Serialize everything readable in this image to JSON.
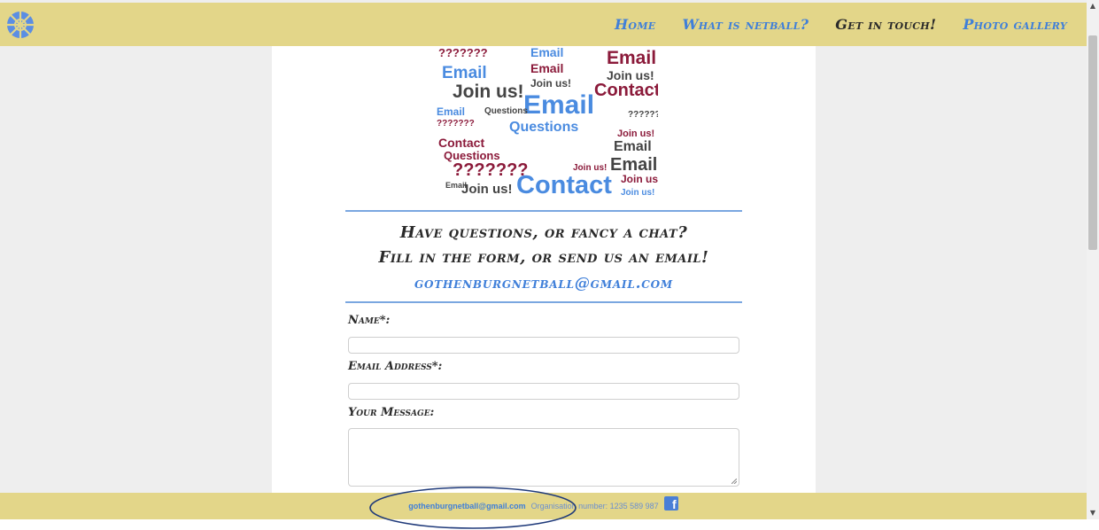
{
  "navbar": {
    "logo_icon": "netball-icon",
    "links": [
      {
        "label": "Home",
        "active": false
      },
      {
        "label": "What is netball?",
        "active": false
      },
      {
        "label": "Get in touch!",
        "active": true
      },
      {
        "label": "Photo gallery",
        "active": false
      }
    ]
  },
  "wordcloud": {
    "image": "contact-wordcloud",
    "words": [
      "Email",
      "Join us!",
      "Contact",
      "Questions",
      "???????"
    ]
  },
  "contact": {
    "line1": "Have questions, or fancy a chat?",
    "line2": "Fill in the form, or send us an email!",
    "email": "gothenburgnetball@gmail.com"
  },
  "form": {
    "name_label": "Name*:",
    "email_label": "Email Address*:",
    "message_label": "Your Message:",
    "name_value": "",
    "email_value": "",
    "message_value": ""
  },
  "footer": {
    "email": "gothenburgnetball@gmail.com",
    "org_number": "Organisation number: 1235 589 987",
    "social_icon": "facebook-icon"
  },
  "colors": {
    "bar": "#e3d689",
    "accent": "#3f7fd9",
    "background": "#eeeeee",
    "divider": "#7aa7e0",
    "annotation": "#1f3a7a"
  }
}
